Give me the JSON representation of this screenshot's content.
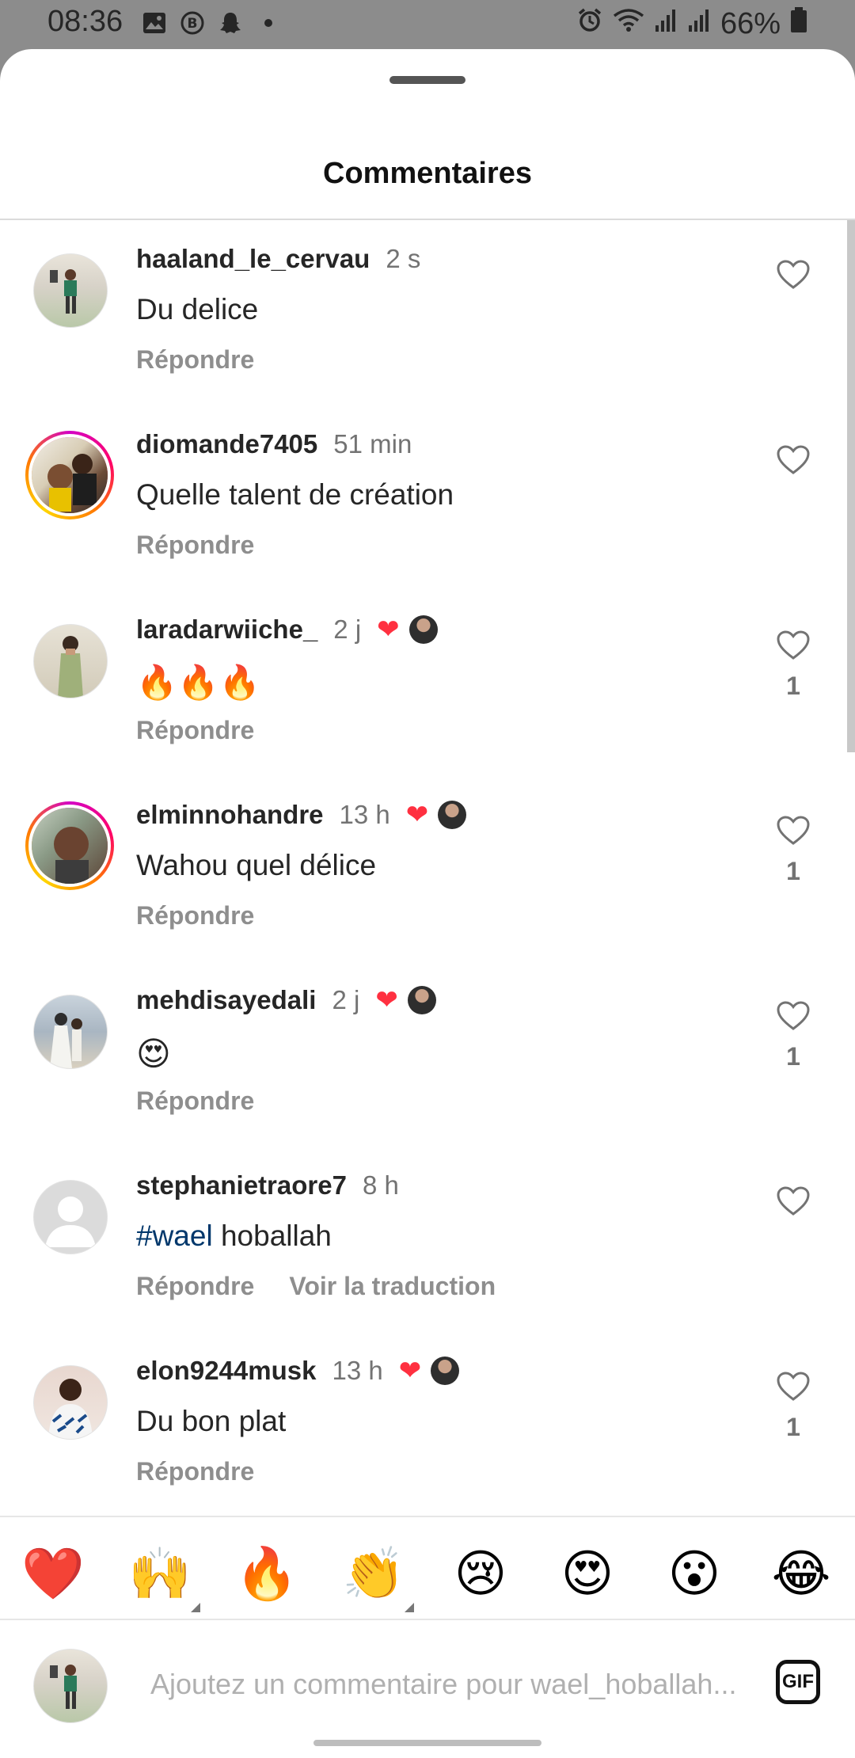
{
  "status_bar": {
    "time": "08:36",
    "battery": "66%"
  },
  "sheet": {
    "title": "Commentaires"
  },
  "comments": [
    {
      "user": "haaland_le_cervau",
      "time": "2 s",
      "text": "Du delice",
      "reply": "Répondre",
      "liked_by_author": false,
      "likes": ""
    },
    {
      "user": "diomande7405",
      "time": "51 min",
      "text": "Quelle talent de création",
      "reply": "Répondre",
      "liked_by_author": false,
      "likes": ""
    },
    {
      "user": "laradarwiiche_",
      "time": "2 j",
      "text": "🔥🔥🔥",
      "reply": "Répondre",
      "liked_by_author": true,
      "likes": "1"
    },
    {
      "user": "elminnohandre",
      "time": "13 h",
      "text": "Wahou quel délice",
      "reply": "Répondre",
      "liked_by_author": true,
      "likes": "1"
    },
    {
      "user": "mehdisayedali",
      "time": "2 j",
      "text": "😍",
      "reply": "Répondre",
      "liked_by_author": true,
      "likes": "1"
    },
    {
      "user": "stephanietraore7",
      "time": "8 h",
      "hashtag": "#wael",
      "text_rest": " hoballah",
      "reply": "Répondre",
      "translate": "Voir la traduction",
      "liked_by_author": false,
      "likes": ""
    },
    {
      "user": "elon9244musk",
      "time": "13 h",
      "text": "Du bon plat",
      "reply": "Répondre",
      "liked_by_author": true,
      "likes": "1"
    }
  ],
  "emoji_bar": [
    "❤️",
    "🙌",
    "🔥",
    "👏",
    "😢",
    "😍",
    "😮",
    "😂"
  ],
  "composer": {
    "placeholder": "Ajoutez un commentaire pour wael_hoballah...",
    "gif_label": "GIF"
  },
  "colors": {
    "accent_like": "#ff3040",
    "hashtag": "#00376b",
    "secondary_text": "#737373"
  }
}
